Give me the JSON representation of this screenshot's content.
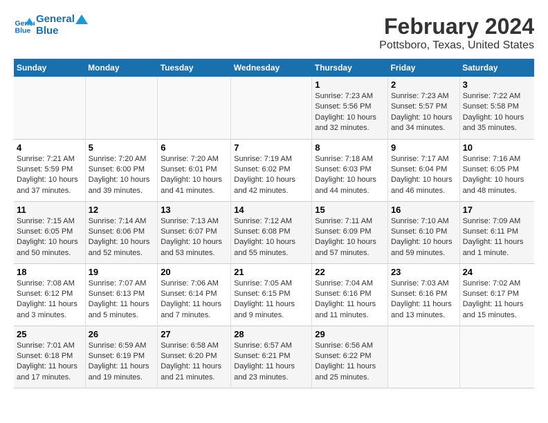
{
  "header": {
    "logo_line1": "General",
    "logo_line2": "Blue",
    "title": "February 2024",
    "subtitle": "Pottsboro, Texas, United States"
  },
  "weekdays": [
    "Sunday",
    "Monday",
    "Tuesday",
    "Wednesday",
    "Thursday",
    "Friday",
    "Saturday"
  ],
  "weeks": [
    [
      {
        "day": "",
        "empty": true
      },
      {
        "day": "",
        "empty": true
      },
      {
        "day": "",
        "empty": true
      },
      {
        "day": "",
        "empty": true
      },
      {
        "day": "1",
        "sunrise": "7:23 AM",
        "sunset": "5:56 PM",
        "daylight": "10 hours and 32 minutes."
      },
      {
        "day": "2",
        "sunrise": "7:23 AM",
        "sunset": "5:57 PM",
        "daylight": "10 hours and 34 minutes."
      },
      {
        "day": "3",
        "sunrise": "7:22 AM",
        "sunset": "5:58 PM",
        "daylight": "10 hours and 35 minutes."
      }
    ],
    [
      {
        "day": "4",
        "sunrise": "7:21 AM",
        "sunset": "5:59 PM",
        "daylight": "10 hours and 37 minutes."
      },
      {
        "day": "5",
        "sunrise": "7:20 AM",
        "sunset": "6:00 PM",
        "daylight": "10 hours and 39 minutes."
      },
      {
        "day": "6",
        "sunrise": "7:20 AM",
        "sunset": "6:01 PM",
        "daylight": "10 hours and 41 minutes."
      },
      {
        "day": "7",
        "sunrise": "7:19 AM",
        "sunset": "6:02 PM",
        "daylight": "10 hours and 42 minutes."
      },
      {
        "day": "8",
        "sunrise": "7:18 AM",
        "sunset": "6:03 PM",
        "daylight": "10 hours and 44 minutes."
      },
      {
        "day": "9",
        "sunrise": "7:17 AM",
        "sunset": "6:04 PM",
        "daylight": "10 hours and 46 minutes."
      },
      {
        "day": "10",
        "sunrise": "7:16 AM",
        "sunset": "6:05 PM",
        "daylight": "10 hours and 48 minutes."
      }
    ],
    [
      {
        "day": "11",
        "sunrise": "7:15 AM",
        "sunset": "6:05 PM",
        "daylight": "10 hours and 50 minutes."
      },
      {
        "day": "12",
        "sunrise": "7:14 AM",
        "sunset": "6:06 PM",
        "daylight": "10 hours and 52 minutes."
      },
      {
        "day": "13",
        "sunrise": "7:13 AM",
        "sunset": "6:07 PM",
        "daylight": "10 hours and 53 minutes."
      },
      {
        "day": "14",
        "sunrise": "7:12 AM",
        "sunset": "6:08 PM",
        "daylight": "10 hours and 55 minutes."
      },
      {
        "day": "15",
        "sunrise": "7:11 AM",
        "sunset": "6:09 PM",
        "daylight": "10 hours and 57 minutes."
      },
      {
        "day": "16",
        "sunrise": "7:10 AM",
        "sunset": "6:10 PM",
        "daylight": "10 hours and 59 minutes."
      },
      {
        "day": "17",
        "sunrise": "7:09 AM",
        "sunset": "6:11 PM",
        "daylight": "11 hours and 1 minute."
      }
    ],
    [
      {
        "day": "18",
        "sunrise": "7:08 AM",
        "sunset": "6:12 PM",
        "daylight": "11 hours and 3 minutes."
      },
      {
        "day": "19",
        "sunrise": "7:07 AM",
        "sunset": "6:13 PM",
        "daylight": "11 hours and 5 minutes."
      },
      {
        "day": "20",
        "sunrise": "7:06 AM",
        "sunset": "6:14 PM",
        "daylight": "11 hours and 7 minutes."
      },
      {
        "day": "21",
        "sunrise": "7:05 AM",
        "sunset": "6:15 PM",
        "daylight": "11 hours and 9 minutes."
      },
      {
        "day": "22",
        "sunrise": "7:04 AM",
        "sunset": "6:16 PM",
        "daylight": "11 hours and 11 minutes."
      },
      {
        "day": "23",
        "sunrise": "7:03 AM",
        "sunset": "6:16 PM",
        "daylight": "11 hours and 13 minutes."
      },
      {
        "day": "24",
        "sunrise": "7:02 AM",
        "sunset": "6:17 PM",
        "daylight": "11 hours and 15 minutes."
      }
    ],
    [
      {
        "day": "25",
        "sunrise": "7:01 AM",
        "sunset": "6:18 PM",
        "daylight": "11 hours and 17 minutes."
      },
      {
        "day": "26",
        "sunrise": "6:59 AM",
        "sunset": "6:19 PM",
        "daylight": "11 hours and 19 minutes."
      },
      {
        "day": "27",
        "sunrise": "6:58 AM",
        "sunset": "6:20 PM",
        "daylight": "11 hours and 21 minutes."
      },
      {
        "day": "28",
        "sunrise": "6:57 AM",
        "sunset": "6:21 PM",
        "daylight": "11 hours and 23 minutes."
      },
      {
        "day": "29",
        "sunrise": "6:56 AM",
        "sunset": "6:22 PM",
        "daylight": "11 hours and 25 minutes."
      },
      {
        "day": "",
        "empty": true
      },
      {
        "day": "",
        "empty": true
      }
    ]
  ],
  "daylight_label": "Daylight:"
}
